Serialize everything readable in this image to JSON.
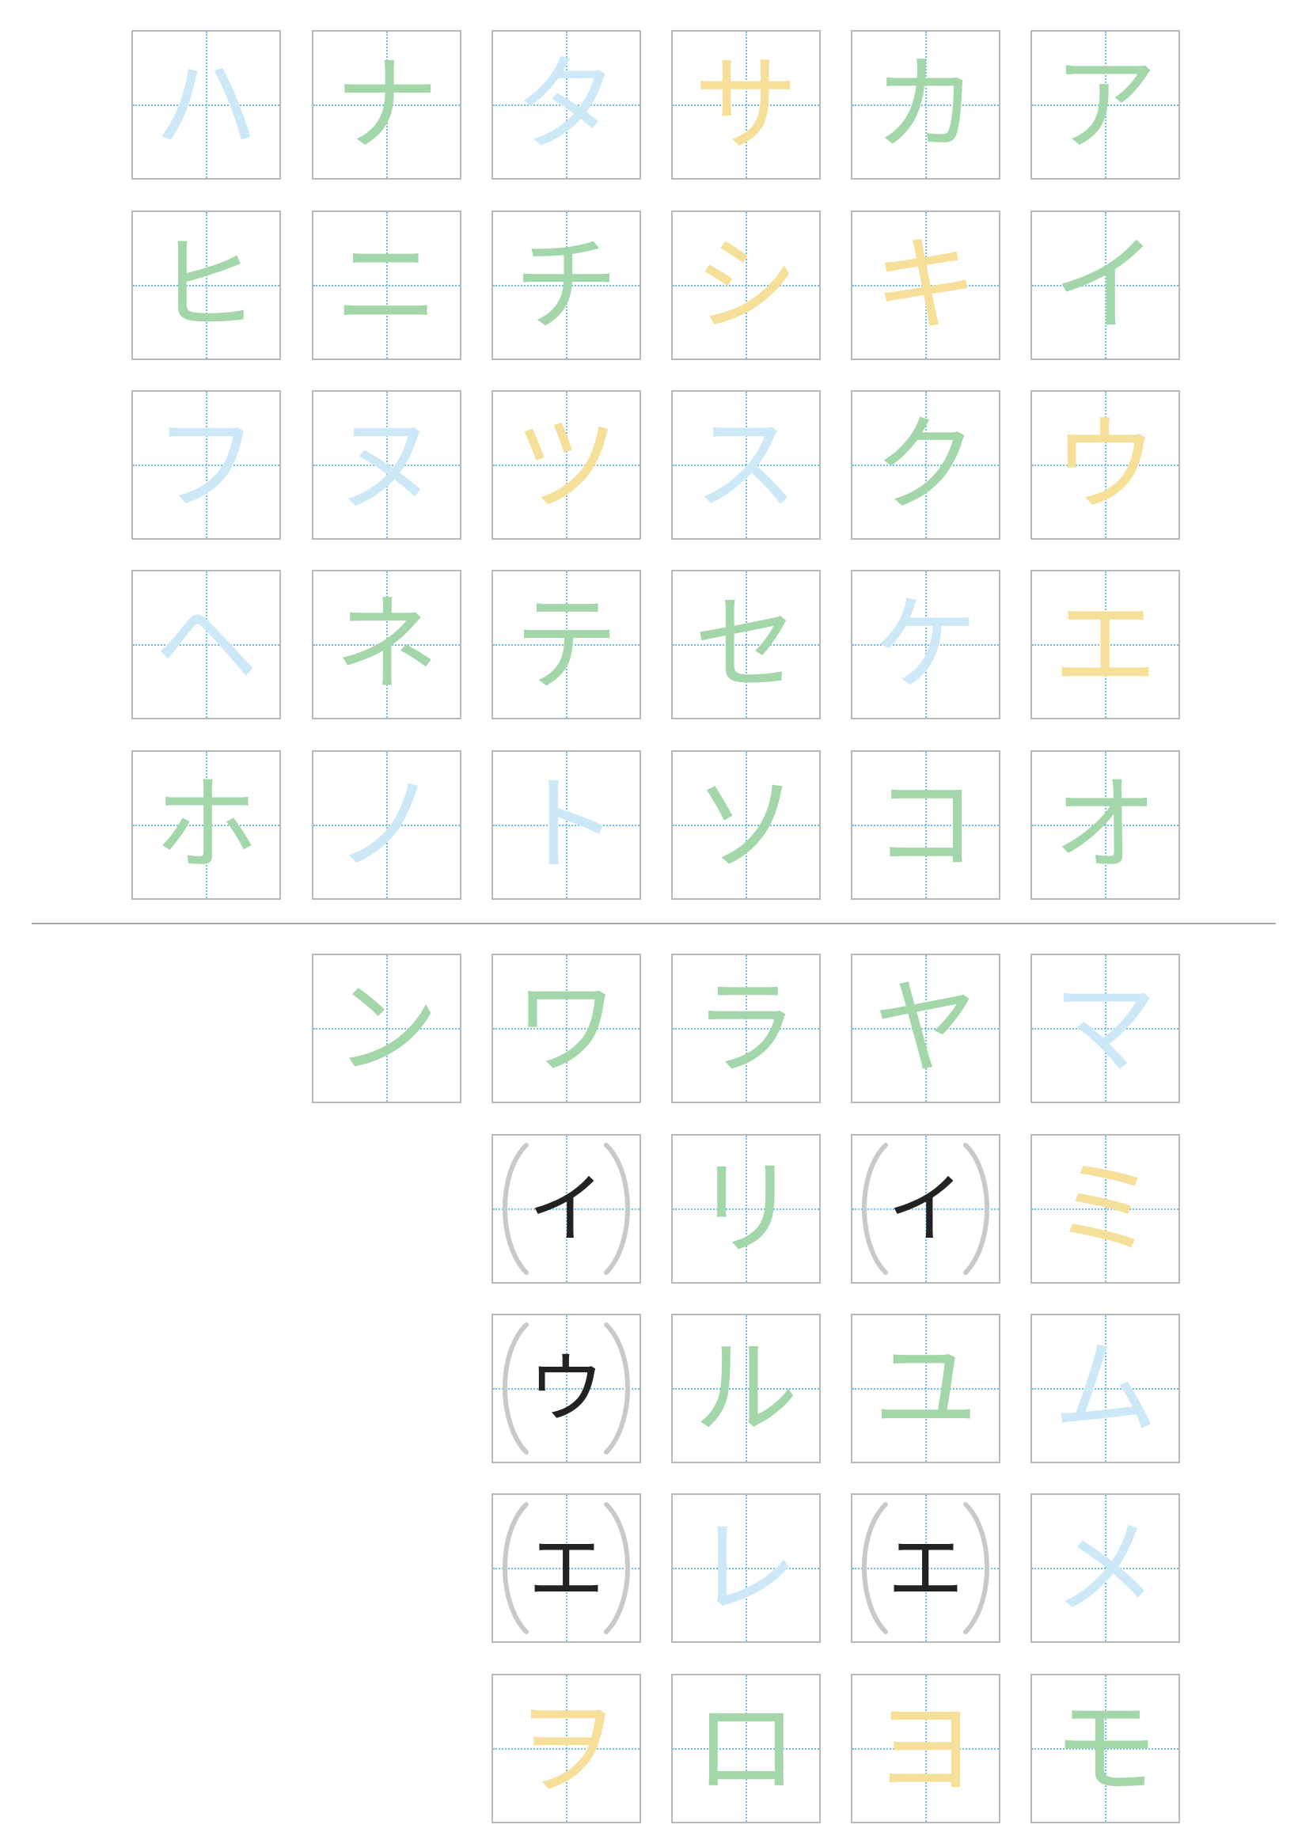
{
  "grid_top": [
    [
      "ハ",
      "ナ",
      "タ",
      "サ",
      "カ",
      "ア"
    ],
    [
      "ヒ",
      "ニ",
      "チ",
      "シ",
      "キ",
      "イ"
    ],
    [
      "フ",
      "ヌ",
      "ツ",
      "ス",
      "ク",
      "ウ"
    ],
    [
      "ヘ",
      "ネ",
      "テ",
      "セ",
      "ケ",
      "エ"
    ],
    [
      "ホ",
      "ノ",
      "ト",
      "ソ",
      "コ",
      "オ"
    ]
  ],
  "grid_bottom": [
    [
      "ン",
      "ワ",
      "ラ",
      "ヤ",
      "マ"
    ],
    [
      "(イ)",
      "リ",
      "(イ)",
      "ミ"
    ],
    [
      "(ウ)",
      "ル",
      "ユ",
      "ム"
    ],
    [
      "(エ)",
      "レ",
      "(エ)",
      "メ"
    ],
    [
      "ヲ",
      "ロ",
      "ヨ",
      "モ"
    ]
  ],
  "colors": {
    "stroke_light_blue": "#cde9f8",
    "stroke_green": "#a3d6a8",
    "stroke_yellow": "#f6df98",
    "guide_line": "#6cc0ea",
    "cell_border": "#b9b9b9"
  }
}
